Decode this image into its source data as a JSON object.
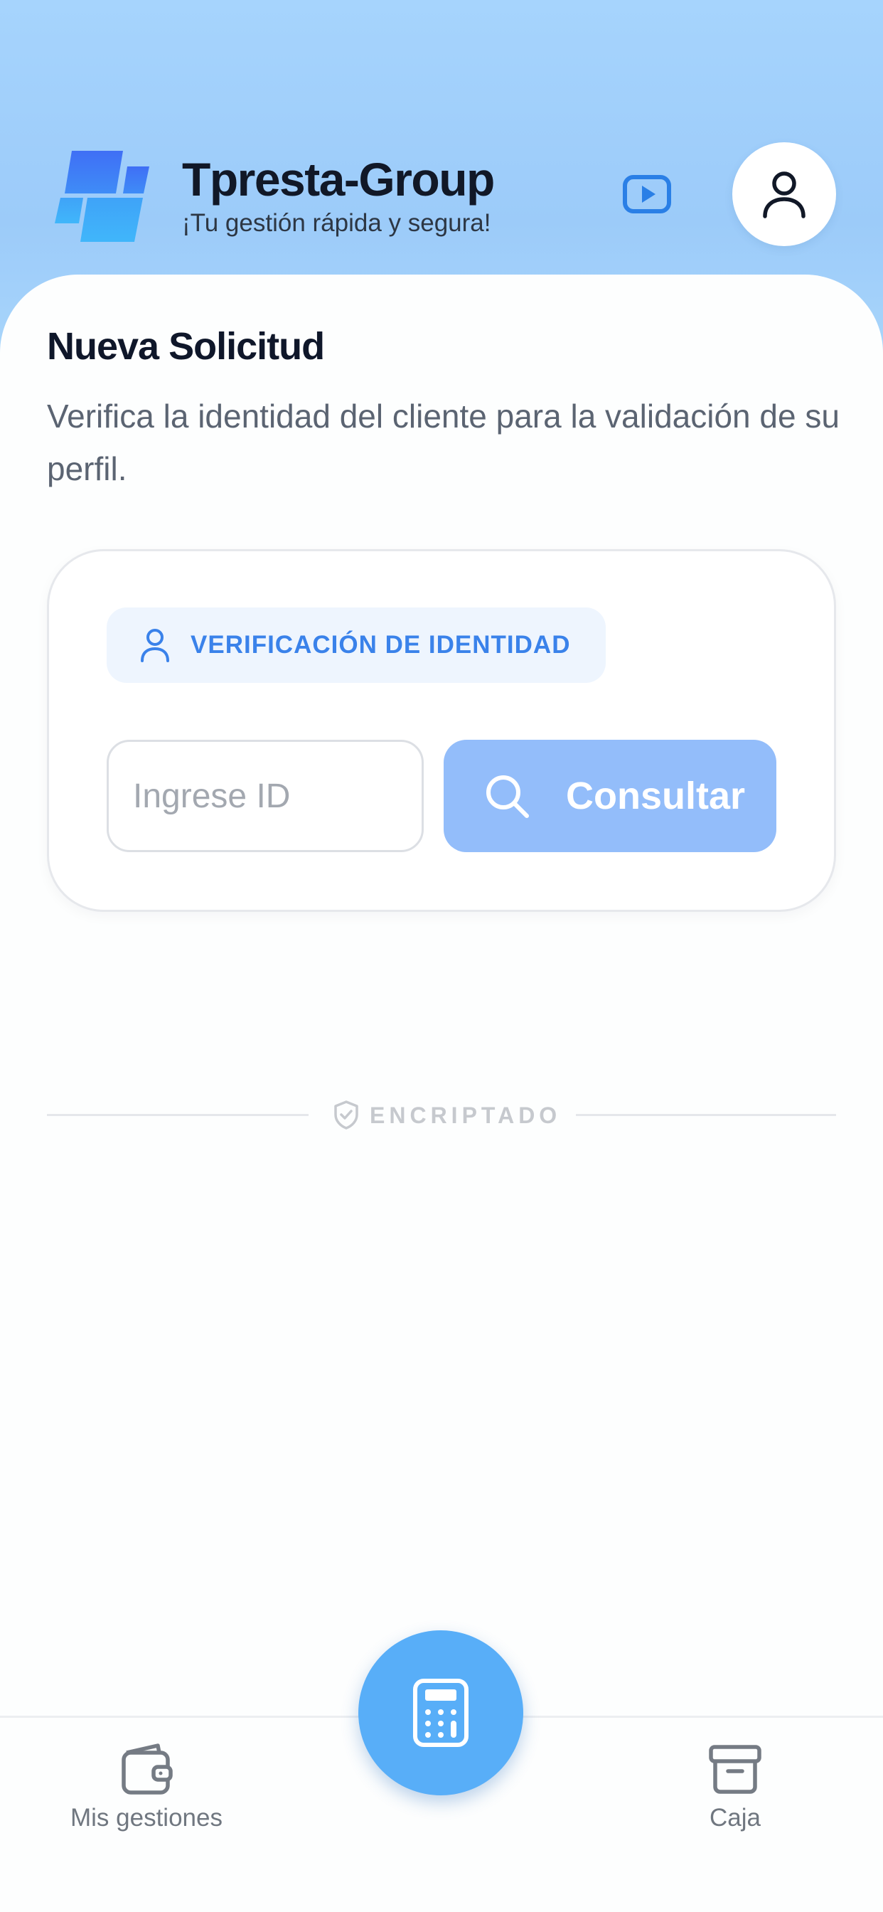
{
  "app": {
    "title": "Tpresta-Group",
    "subtitle": "¡Tu gestión rápida y segura!"
  },
  "header": {
    "video_icon": "youtube-play-icon",
    "profile_icon": "user-icon"
  },
  "main": {
    "title": "Nueva Solicitud",
    "description": "Verifica la identidad del cliente para la validación de su perfil."
  },
  "card": {
    "badge_label": "VERIFICACIÓN DE IDENTIDAD",
    "badge_icon": "user-icon",
    "input": {
      "placeholder": "Ingrese ID",
      "value": ""
    },
    "button_label": "Consultar",
    "button_icon": "search-icon"
  },
  "security": {
    "label": "ENCRIPTADO",
    "icon": "shield-check-icon"
  },
  "bottom_nav": {
    "items": [
      {
        "label": "Mis gestiones",
        "icon": "wallet-icon"
      },
      {
        "label": "Caja",
        "icon": "archive-box-icon"
      }
    ],
    "fab_icon": "calculator-icon"
  },
  "colors": {
    "header_gradient_top": "#a6d4fd",
    "accent_blue": "#3a82ea",
    "button_blue": "#93bdfa",
    "fab_blue": "#58aef8",
    "badge_bg": "#eef5fe"
  }
}
